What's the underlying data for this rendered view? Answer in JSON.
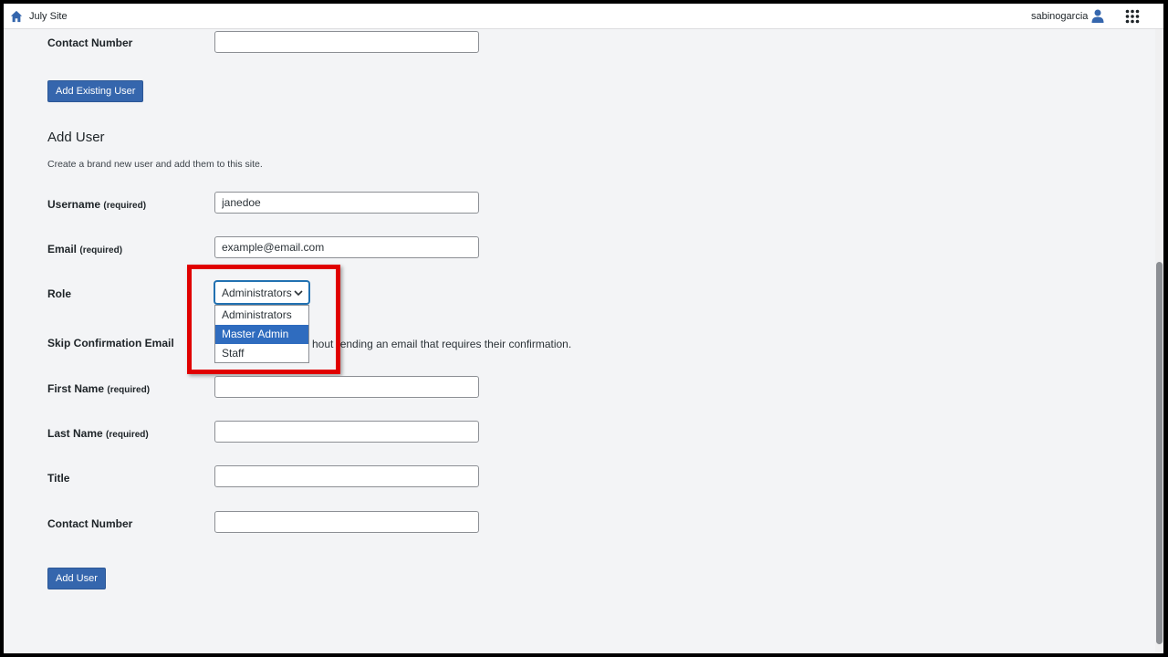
{
  "topbar": {
    "site_title": "July Site",
    "username": "sabinogarcia",
    "home_icon": "home-icon",
    "user_icon": "user-icon",
    "apps_icon": "grid-icon"
  },
  "existing_user": {
    "contact_label": "Contact Number",
    "contact_value": "",
    "add_button": "Add Existing User"
  },
  "add_user": {
    "heading": "Add User",
    "description": "Create a brand new user and add them to this site.",
    "required_suffix": "(required)",
    "username_label": "Username",
    "username_value": "janedoe",
    "email_label": "Email",
    "email_value": "example@email.com",
    "role_label": "Role",
    "role_selected": "Administrators",
    "role_options": [
      "Administrators",
      "Master Admin",
      "Staff"
    ],
    "role_highlighted": "Master Admin",
    "skip_label": "Skip Confirmation Email",
    "skip_text_visible": "hout ",
    "skip_text_visible_2": "ending an email that requires their confirmation.",
    "first_name_label": "First Name",
    "last_name_label": "Last Name",
    "title_label": "Title",
    "contact_label": "Contact Number",
    "submit_button": "Add User"
  },
  "colors": {
    "accent": "#3566ad",
    "highlight_border": "#e00000",
    "selected_option": "#2f6cbf"
  }
}
